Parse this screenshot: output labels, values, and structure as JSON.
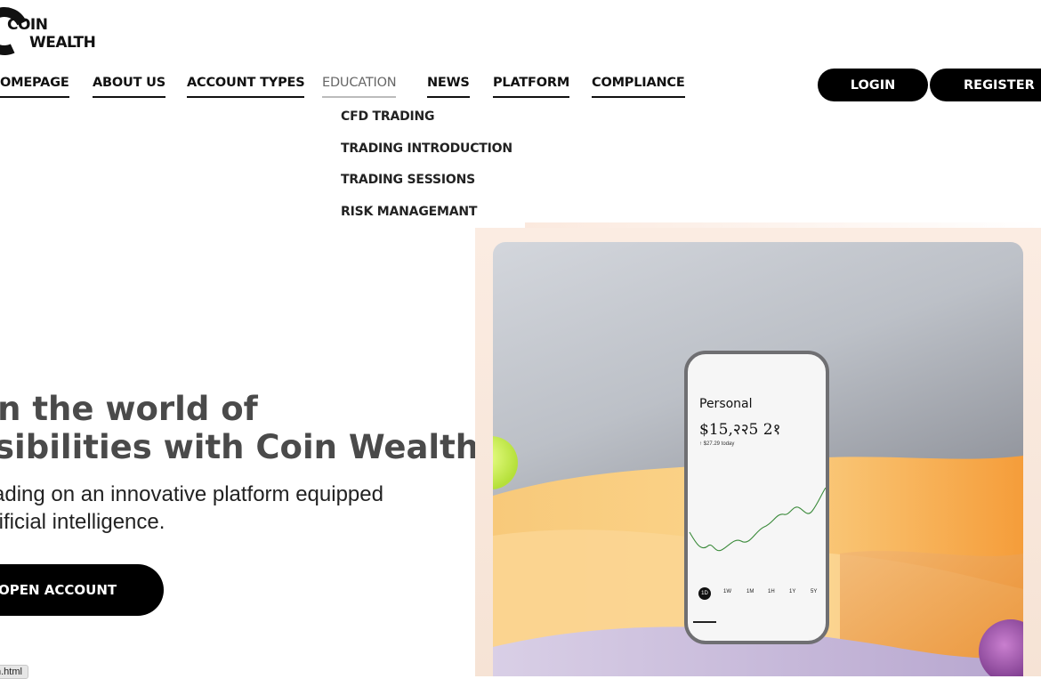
{
  "brand": {
    "line1": "COIN",
    "line2": "WEALTH"
  },
  "nav": {
    "items": [
      "OMEPAGE",
      "ABOUT US",
      "ACCOUNT TYPES",
      "EDUCATION",
      "NEWS",
      "PLATFORM",
      "COMPLIANCE"
    ],
    "active": "EDUCATION"
  },
  "education_dropdown": [
    "CFD TRADING",
    "TRADING INTRODUCTION",
    "TRADING SESSIONS",
    "RISK MANAGEMANT"
  ],
  "auth": {
    "login": "LOGIN",
    "register": "REGISTER"
  },
  "hero": {
    "title_line1": "en the world of",
    "title_line2": "ssibilities with Coin Wealth",
    "sub_line1": "rading on an innovative platform equipped",
    "sub_line2": "rtificial intelligence.",
    "cta": "OPEN ACCOUNT"
  },
  "phone": {
    "title": "Personal",
    "balance": "$15,२२5 2१",
    "change": "↑ $27.29 today",
    "ranges": [
      "1D",
      "1W",
      "1M",
      "1H",
      "1Y",
      "5Y"
    ],
    "selected_range": "1D"
  },
  "status_tooltip": "n.html",
  "colors": {
    "accent": "#000000",
    "title_gray": "#4a4a4a"
  }
}
